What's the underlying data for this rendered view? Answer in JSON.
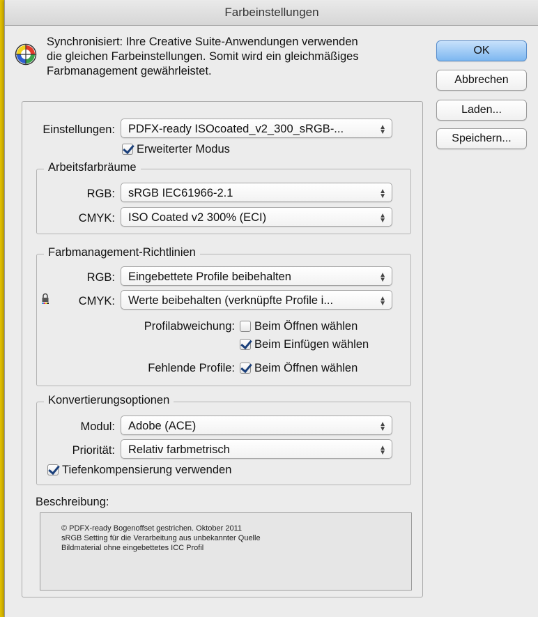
{
  "window": {
    "title": "Farbeinstellungen"
  },
  "info": {
    "line1": "Synchronisiert: Ihre Creative Suite-Anwendungen verwenden",
    "line2": "die gleichen Farbeinstellungen. Somit wird ein gleichmäßiges",
    "line3": "Farbmanagement gewährleistet.",
    "icon": "color-wheel-icon"
  },
  "buttons": {
    "ok": "OK",
    "cancel": "Abbrechen",
    "load": "Laden...",
    "save": "Speichern..."
  },
  "settings": {
    "label": "Einstellungen:",
    "value": "PDFX-ready ISOcoated_v2_300_sRGB-...",
    "advanced_mode": {
      "label": "Erweiterter Modus",
      "checked": true
    }
  },
  "working_spaces": {
    "title": "Arbeitsfarbräume",
    "rgb_label": "RGB:",
    "rgb_value": "sRGB IEC61966-2.1",
    "cmyk_label": "CMYK:",
    "cmyk_value": "ISO Coated v2 300% (ECI)"
  },
  "policies": {
    "title": "Farbmanagement-Richtlinien",
    "rgb_label": "RGB:",
    "rgb_value": "Eingebettete Profile beibehalten",
    "cmyk_label": "CMYK:",
    "cmyk_value": "Werte beibehalten (verknüpfte Profile i...",
    "mismatch_label": "Profilabweichung:",
    "mismatch_open": {
      "label": "Beim Öffnen wählen",
      "checked": false
    },
    "mismatch_paste": {
      "label": "Beim Einfügen wählen",
      "checked": true
    },
    "missing_label": "Fehlende Profile:",
    "missing_open": {
      "label": "Beim Öffnen wählen",
      "checked": true
    }
  },
  "conversion": {
    "title": "Konvertierungsoptionen",
    "engine_label": "Modul:",
    "engine_value": "Adobe (ACE)",
    "intent_label": "Priorität:",
    "intent_value": "Relativ farbmetrisch",
    "bpc": {
      "label": "Tiefenkompensierung verwenden",
      "checked": true
    }
  },
  "description": {
    "label": "Beschreibung:",
    "line1": "© PDFX-ready Bogenoffset gestrichen. Oktober 2011",
    "line2": "sRGB Setting für die Verarbeitung aus unbekannter Quelle",
    "line3": "Bildmaterial ohne eingebettetes ICC Profil"
  },
  "colors": {
    "accent": "#7db7f0",
    "window_bg": "#ececec",
    "backdrop": "#e3c000"
  }
}
